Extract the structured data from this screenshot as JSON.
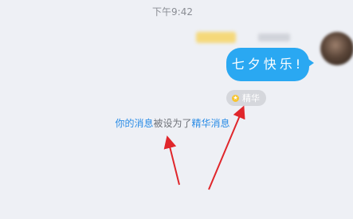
{
  "header": {
    "timestamp": "下午9:42"
  },
  "message": {
    "text": "七夕快乐!",
    "bubble_color": "#2aa8f2"
  },
  "essence_tag": {
    "label": "精华",
    "icon": "star-icon"
  },
  "system_notice": {
    "link_your_message": "你的消息",
    "middle_text": "被设为了",
    "link_essence_message": "精华消息"
  },
  "annotations": {
    "arrow_color": "#e0262b"
  }
}
